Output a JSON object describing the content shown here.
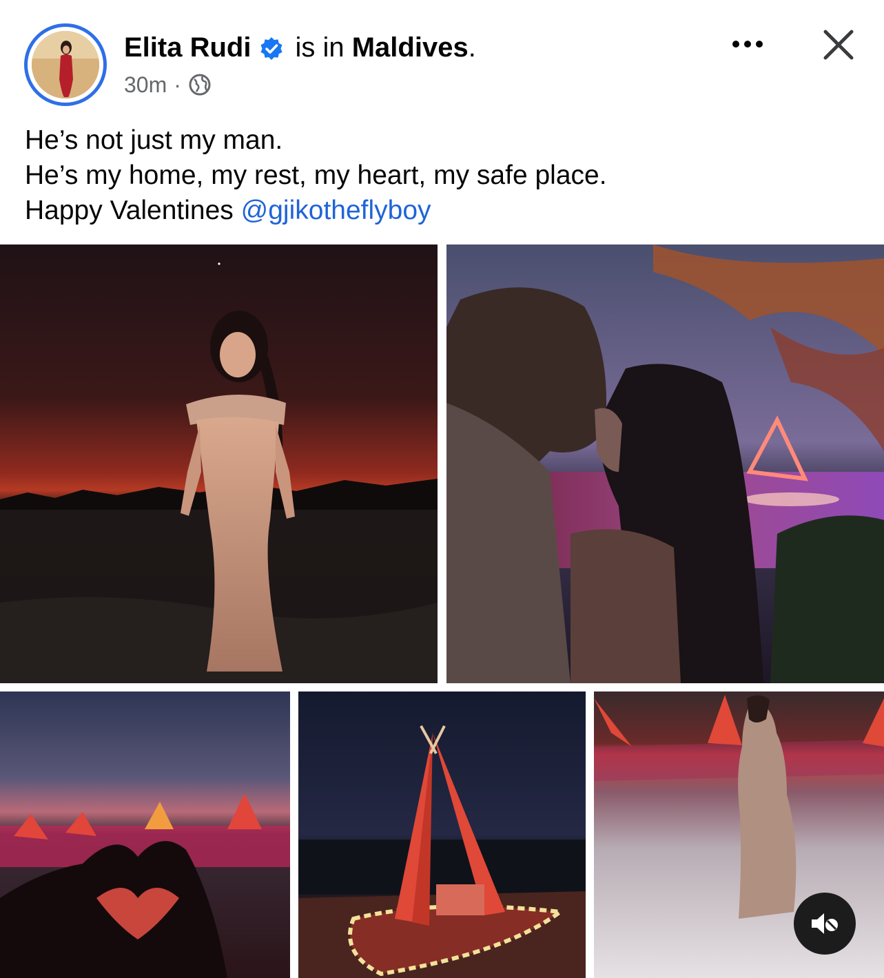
{
  "post": {
    "author": "Elita Rudi",
    "checkin_prefix": "is in",
    "place": "Maldives",
    "checkin_suffix": ".",
    "time_ago": "30m",
    "separator": "·",
    "audience_icon": "globe-icon",
    "verified_icon": "verified-badge-icon",
    "caption_lines": [
      "He’s not just my man.",
      "He’s my home, my rest, my heart, my safe place.",
      "Happy Valentines "
    ],
    "mention": "@gjikotheflyboy"
  },
  "header_actions": {
    "more_icon": "more-options-icon",
    "close_icon": "close-icon"
  },
  "gallery": {
    "photos": [
      {
        "id": "photo-1",
        "kind": "image"
      },
      {
        "id": "photo-2",
        "kind": "image"
      },
      {
        "id": "photo-3",
        "kind": "image"
      },
      {
        "id": "photo-4",
        "kind": "image"
      },
      {
        "id": "photo-5",
        "kind": "video"
      }
    ],
    "video_control_icon": "muted-speaker-icon"
  },
  "colors": {
    "verified_blue": "#1877f2",
    "story_ring": "#2f6fe6",
    "mention_blue": "#1f64d8",
    "meta_gray": "#65676b"
  }
}
